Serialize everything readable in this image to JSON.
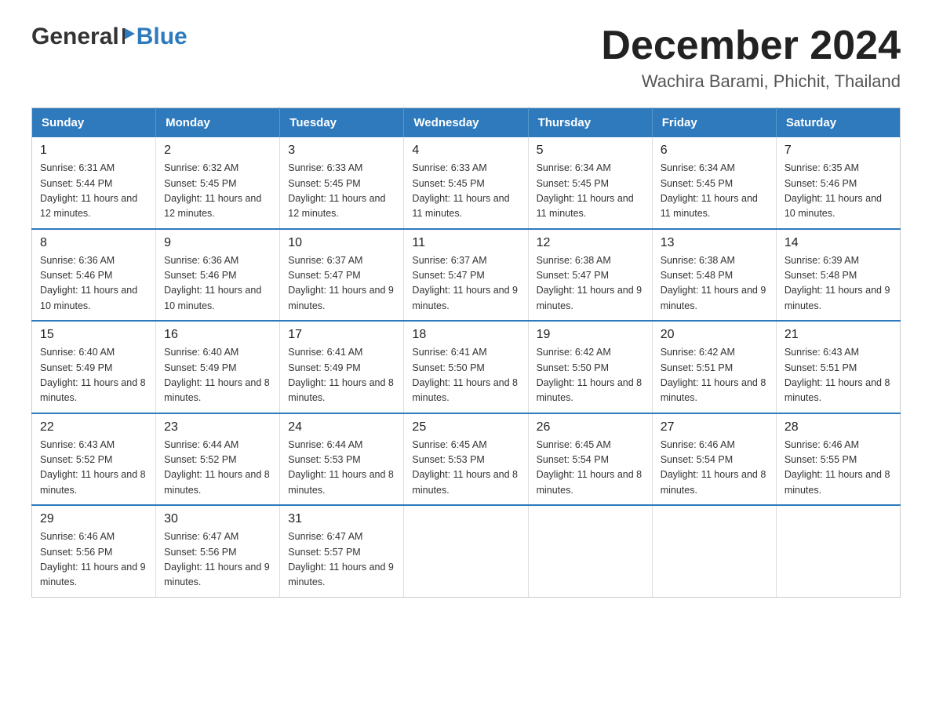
{
  "header": {
    "logo_general": "General",
    "logo_blue": "Blue",
    "title": "December 2024",
    "location": "Wachira Barami, Phichit, Thailand"
  },
  "calendar": {
    "days_of_week": [
      "Sunday",
      "Monday",
      "Tuesday",
      "Wednesday",
      "Thursday",
      "Friday",
      "Saturday"
    ],
    "weeks": [
      [
        {
          "day": "1",
          "sunrise": "6:31 AM",
          "sunset": "5:44 PM",
          "daylight": "11 hours and 12 minutes."
        },
        {
          "day": "2",
          "sunrise": "6:32 AM",
          "sunset": "5:45 PM",
          "daylight": "11 hours and 12 minutes."
        },
        {
          "day": "3",
          "sunrise": "6:33 AM",
          "sunset": "5:45 PM",
          "daylight": "11 hours and 12 minutes."
        },
        {
          "day": "4",
          "sunrise": "6:33 AM",
          "sunset": "5:45 PM",
          "daylight": "11 hours and 11 minutes."
        },
        {
          "day": "5",
          "sunrise": "6:34 AM",
          "sunset": "5:45 PM",
          "daylight": "11 hours and 11 minutes."
        },
        {
          "day": "6",
          "sunrise": "6:34 AM",
          "sunset": "5:45 PM",
          "daylight": "11 hours and 11 minutes."
        },
        {
          "day": "7",
          "sunrise": "6:35 AM",
          "sunset": "5:46 PM",
          "daylight": "11 hours and 10 minutes."
        }
      ],
      [
        {
          "day": "8",
          "sunrise": "6:36 AM",
          "sunset": "5:46 PM",
          "daylight": "11 hours and 10 minutes."
        },
        {
          "day": "9",
          "sunrise": "6:36 AM",
          "sunset": "5:46 PM",
          "daylight": "11 hours and 10 minutes."
        },
        {
          "day": "10",
          "sunrise": "6:37 AM",
          "sunset": "5:47 PM",
          "daylight": "11 hours and 9 minutes."
        },
        {
          "day": "11",
          "sunrise": "6:37 AM",
          "sunset": "5:47 PM",
          "daylight": "11 hours and 9 minutes."
        },
        {
          "day": "12",
          "sunrise": "6:38 AM",
          "sunset": "5:47 PM",
          "daylight": "11 hours and 9 minutes."
        },
        {
          "day": "13",
          "sunrise": "6:38 AM",
          "sunset": "5:48 PM",
          "daylight": "11 hours and 9 minutes."
        },
        {
          "day": "14",
          "sunrise": "6:39 AM",
          "sunset": "5:48 PM",
          "daylight": "11 hours and 9 minutes."
        }
      ],
      [
        {
          "day": "15",
          "sunrise": "6:40 AM",
          "sunset": "5:49 PM",
          "daylight": "11 hours and 8 minutes."
        },
        {
          "day": "16",
          "sunrise": "6:40 AM",
          "sunset": "5:49 PM",
          "daylight": "11 hours and 8 minutes."
        },
        {
          "day": "17",
          "sunrise": "6:41 AM",
          "sunset": "5:49 PM",
          "daylight": "11 hours and 8 minutes."
        },
        {
          "day": "18",
          "sunrise": "6:41 AM",
          "sunset": "5:50 PM",
          "daylight": "11 hours and 8 minutes."
        },
        {
          "day": "19",
          "sunrise": "6:42 AM",
          "sunset": "5:50 PM",
          "daylight": "11 hours and 8 minutes."
        },
        {
          "day": "20",
          "sunrise": "6:42 AM",
          "sunset": "5:51 PM",
          "daylight": "11 hours and 8 minutes."
        },
        {
          "day": "21",
          "sunrise": "6:43 AM",
          "sunset": "5:51 PM",
          "daylight": "11 hours and 8 minutes."
        }
      ],
      [
        {
          "day": "22",
          "sunrise": "6:43 AM",
          "sunset": "5:52 PM",
          "daylight": "11 hours and 8 minutes."
        },
        {
          "day": "23",
          "sunrise": "6:44 AM",
          "sunset": "5:52 PM",
          "daylight": "11 hours and 8 minutes."
        },
        {
          "day": "24",
          "sunrise": "6:44 AM",
          "sunset": "5:53 PM",
          "daylight": "11 hours and 8 minutes."
        },
        {
          "day": "25",
          "sunrise": "6:45 AM",
          "sunset": "5:53 PM",
          "daylight": "11 hours and 8 minutes."
        },
        {
          "day": "26",
          "sunrise": "6:45 AM",
          "sunset": "5:54 PM",
          "daylight": "11 hours and 8 minutes."
        },
        {
          "day": "27",
          "sunrise": "6:46 AM",
          "sunset": "5:54 PM",
          "daylight": "11 hours and 8 minutes."
        },
        {
          "day": "28",
          "sunrise": "6:46 AM",
          "sunset": "5:55 PM",
          "daylight": "11 hours and 8 minutes."
        }
      ],
      [
        {
          "day": "29",
          "sunrise": "6:46 AM",
          "sunset": "5:56 PM",
          "daylight": "11 hours and 9 minutes."
        },
        {
          "day": "30",
          "sunrise": "6:47 AM",
          "sunset": "5:56 PM",
          "daylight": "11 hours and 9 minutes."
        },
        {
          "day": "31",
          "sunrise": "6:47 AM",
          "sunset": "5:57 PM",
          "daylight": "11 hours and 9 minutes."
        },
        null,
        null,
        null,
        null
      ]
    ]
  }
}
